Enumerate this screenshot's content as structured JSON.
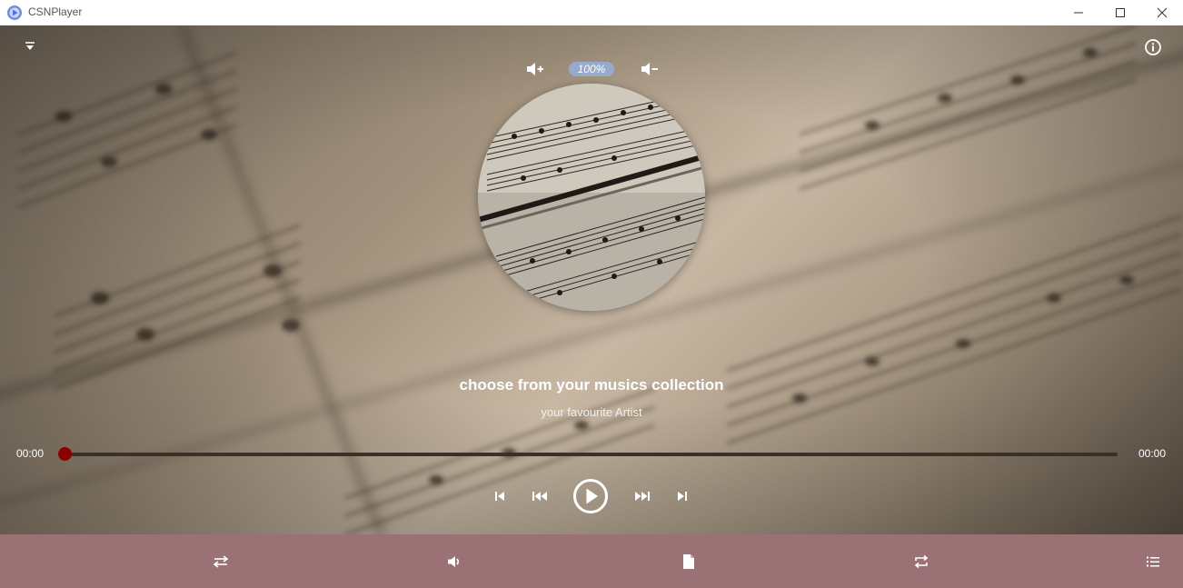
{
  "window": {
    "title": "CSNPlayer",
    "controls": [
      "minimize",
      "maximize",
      "close"
    ]
  },
  "volume": {
    "level_label": "100%",
    "level": 1.0,
    "increase_icon": "volume-plus-icon",
    "decrease_icon": "volume-minus-icon"
  },
  "track": {
    "title": "choose from your musics collection",
    "artist": "your favourite Artist"
  },
  "progress": {
    "current_time": "00:00",
    "total_time": "00:00",
    "fraction": 0.0
  },
  "transport": {
    "icons": [
      "skip-to-start-icon",
      "previous-icon",
      "play-circle-icon",
      "next-icon",
      "skip-to-end-icon"
    ]
  },
  "bottom_bar": {
    "icons": [
      "shuffle-icon",
      "speaker-icon",
      "file-icon",
      "repeat-icon",
      "playlist-icon"
    ]
  },
  "colors": {
    "accent": "#8b0000",
    "bottom_bar": "#9a7276",
    "volume_pill": "#96afd7"
  }
}
